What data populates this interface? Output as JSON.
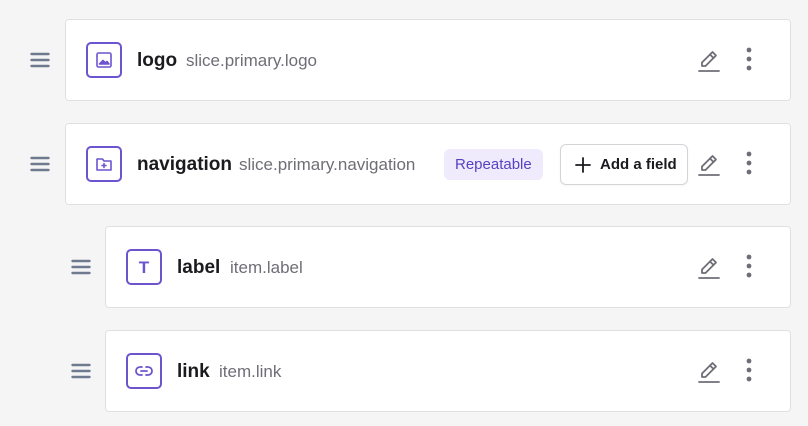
{
  "fields": [
    {
      "name": "logo",
      "path": "slice.primary.logo",
      "icon": "image-icon"
    },
    {
      "name": "navigation",
      "path": "slice.primary.navigation",
      "icon": "folder-plus-icon",
      "badge": "Repeatable",
      "add_field_label": "Add a field"
    },
    {
      "name": "label",
      "path": "item.label",
      "icon": "text-icon",
      "icon_letter": "T"
    },
    {
      "name": "link",
      "path": "item.link",
      "icon": "link-icon"
    }
  ],
  "colors": {
    "accent": "#6d54cf",
    "badge_bg": "#efebfc",
    "badge_text": "#5842c3",
    "handle": "#6f7a8f",
    "action_icon": "#6f6e77"
  },
  "icons": {
    "drag": "drag-handle-icon",
    "edit": "pencil-icon",
    "more": "more-vertical-icon",
    "add": "plus-icon"
  }
}
